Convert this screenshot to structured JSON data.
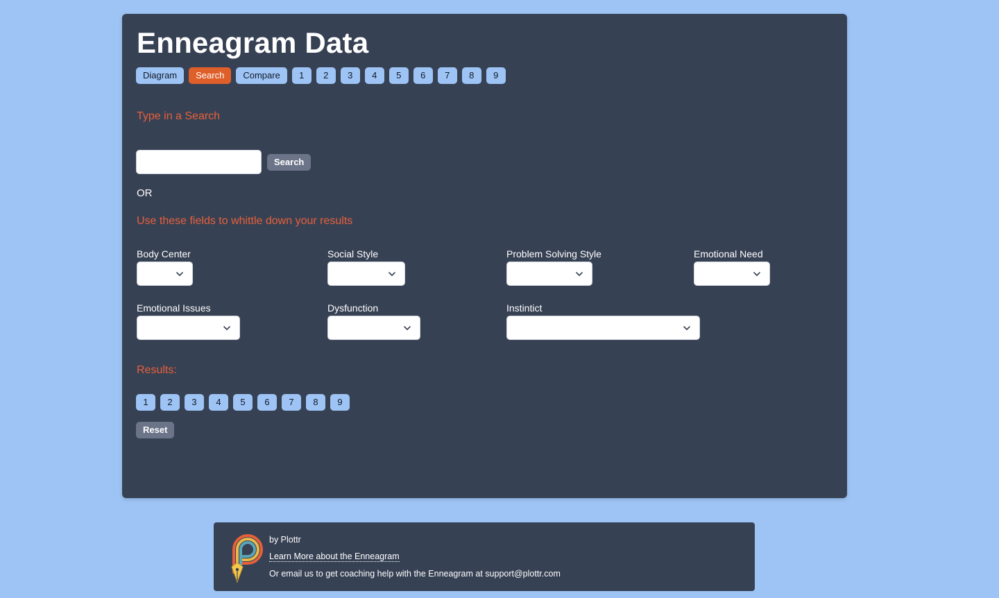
{
  "header": {
    "title": "Enneagram Data"
  },
  "nav": {
    "tabs": [
      {
        "label": "Diagram",
        "active": false
      },
      {
        "label": "Search",
        "active": true
      },
      {
        "label": "Compare",
        "active": false
      }
    ],
    "numbers": [
      "1",
      "2",
      "3",
      "4",
      "5",
      "6",
      "7",
      "8",
      "9"
    ]
  },
  "search": {
    "prompt": "Type in a Search",
    "input_value": "",
    "button_label": "Search",
    "or_label": "OR",
    "filters_prompt": "Use these fields to whittle down your results"
  },
  "filters": [
    {
      "label": "Body Center",
      "value": ""
    },
    {
      "label": "Social Style",
      "value": ""
    },
    {
      "label": "Problem Solving Style",
      "value": ""
    },
    {
      "label": "Emotional Need",
      "value": ""
    },
    {
      "label": "Emotional Issues",
      "value": ""
    },
    {
      "label": "Dysfunction",
      "value": ""
    },
    {
      "label": "Instintict",
      "value": ""
    }
  ],
  "results": {
    "label": "Results:",
    "numbers": [
      "1",
      "2",
      "3",
      "4",
      "5",
      "6",
      "7",
      "8",
      "9"
    ],
    "reset_label": "Reset"
  },
  "footer": {
    "by_line": "by Plottr",
    "learn_link": "Learn More about the Enneagram",
    "email_line": "Or email us to get coaching help with the Enneagram at support@plottr.com"
  },
  "colors": {
    "page_bg": "#9ec4f5",
    "card_bg": "#374154",
    "accent": "#df5f2a",
    "heading_orange": "#e8603a",
    "pill_bg": "#9ec4f5",
    "button_gray": "#6b7488"
  }
}
